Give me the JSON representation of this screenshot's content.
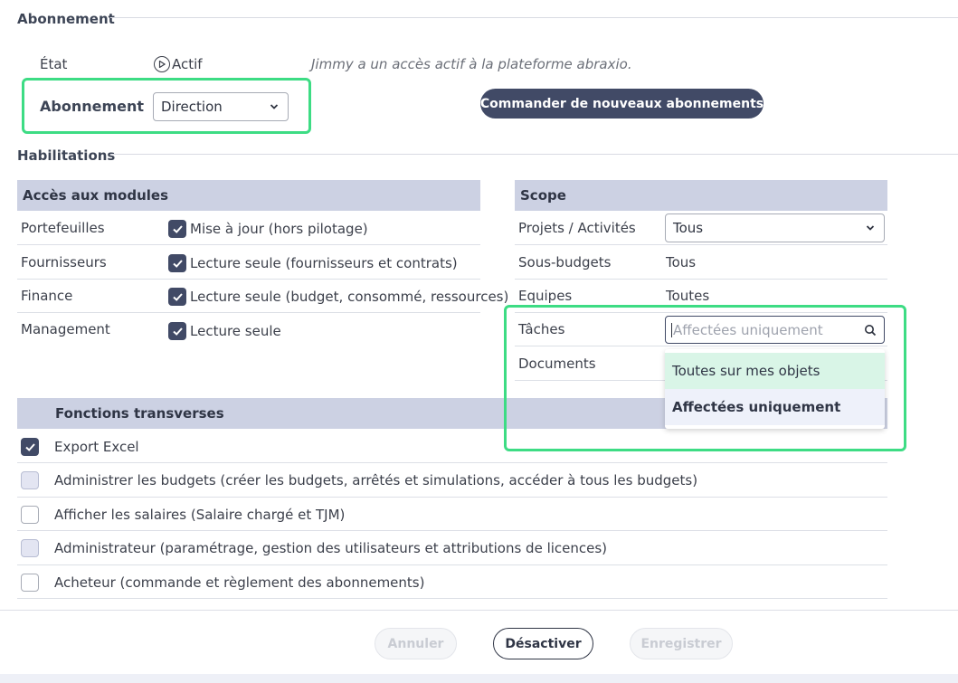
{
  "subscription": {
    "section_title": "Abonnement",
    "state_label": "État",
    "state_value": "Actif",
    "state_note": "Jimmy a un accès actif à la plateforme abraxio.",
    "subscription_label": "Abonnement",
    "required_mark": "*",
    "subscription_value": "Direction",
    "order_button": "Commander de nouveaux abonnements"
  },
  "permissions": {
    "section_title": "Habilitations",
    "modules_header": "Accès aux modules",
    "modules": [
      {
        "name": "Portefeuilles",
        "access": "Mise à jour (hors pilotage)",
        "checked": true
      },
      {
        "name": "Fournisseurs",
        "access": "Lecture seule (fournisseurs et contrats)",
        "checked": true
      },
      {
        "name": "Finance",
        "access": "Lecture seule (budget, consommé, ressources)",
        "checked": true
      },
      {
        "name": "Management",
        "access": "Lecture seule",
        "checked": true
      }
    ],
    "scope_header": "Scope",
    "scope": [
      {
        "name": "Projets / Activités",
        "value": "Tous"
      },
      {
        "name": "Sous-budgets",
        "value": "Tous"
      },
      {
        "name": "Equipes",
        "value": "Toutes"
      },
      {
        "name": "Tâches",
        "placeholder": "Affectées uniquement"
      },
      {
        "name": "Documents",
        "value": ""
      }
    ],
    "task_options": [
      "Toutes sur mes objets",
      "Affectées uniquement"
    ],
    "transverse_header": "Fonctions transverses",
    "transverse": [
      {
        "label": "Export Excel",
        "state": "checked"
      },
      {
        "label": "Administrer les budgets (créer les budgets, arrêtés et simulations, accéder à tous les budgets)",
        "state": "disabled"
      },
      {
        "label": "Afficher les salaires (Salaire chargé et TJM)",
        "state": "empty"
      },
      {
        "label": "Administrateur (paramétrage, gestion des utilisateurs et attributions de licences)",
        "state": "disabled"
      },
      {
        "label": "Acheteur (commande et règlement des abonnements)",
        "state": "empty"
      }
    ]
  },
  "footer": {
    "cancel": "Annuler",
    "deactivate": "Désactiver",
    "save": "Enregistrer"
  },
  "colors": {
    "highlight": "#3ddc84",
    "header_bg": "#ccd1e3",
    "primary": "#414a66",
    "option_selected_bg": "#d9f5e7",
    "option_hover_bg": "#eef1fa"
  }
}
